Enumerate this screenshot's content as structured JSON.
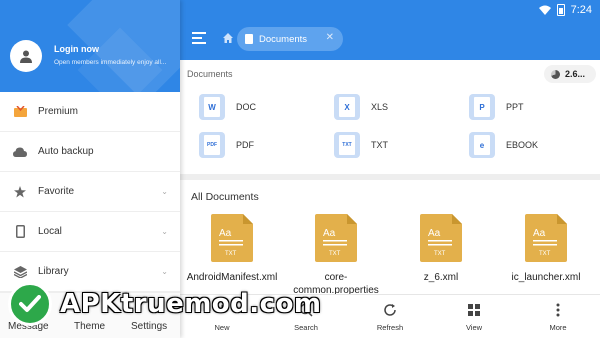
{
  "status_bar": {
    "time": "7:24"
  },
  "drawer": {
    "login_title": "Login now",
    "login_subtitle": "Open members immediately enjoy all...",
    "menu": [
      {
        "label": "Premium",
        "icon": "premium-icon",
        "chevron": false
      },
      {
        "label": "Auto backup",
        "icon": "cloud-upload-icon",
        "chevron": false
      },
      {
        "label": "Favorite",
        "icon": "star-icon",
        "chevron": true
      },
      {
        "label": "Local",
        "icon": "phone-icon",
        "chevron": true
      },
      {
        "label": "Library",
        "icon": "layers-icon",
        "chevron": true
      }
    ],
    "bottom": {
      "message": "Message",
      "theme": "Theme",
      "settings": "Settings"
    }
  },
  "app_bar": {
    "tab_label": "Documents"
  },
  "documents": {
    "section_label": "Documents",
    "storage_value": "2.6...",
    "categories": [
      {
        "label": "DOC",
        "badge": "W",
        "color": "#2f6fd6",
        "bg": "#c9dcf6"
      },
      {
        "label": "XLS",
        "badge": "X",
        "color": "#2f6fd6",
        "bg": "#c9dcf6"
      },
      {
        "label": "PPT",
        "badge": "P",
        "color": "#2f6fd6",
        "bg": "#c9dcf6"
      },
      {
        "label": "PDF",
        "badge": "PDF",
        "color": "#2f6fd6",
        "bg": "#c9dcf6"
      },
      {
        "label": "TXT",
        "badge": "TXT",
        "color": "#2f6fd6",
        "bg": "#c9dcf6"
      },
      {
        "label": "EBOOK",
        "badge": "e",
        "color": "#2f6fd6",
        "bg": "#c9dcf6"
      }
    ]
  },
  "all_documents": {
    "label": "All Documents",
    "file_icon_color": "#e3b04b",
    "files": [
      {
        "name": "AndroidManifest.xml",
        "type": "TXT"
      },
      {
        "name": "core-common.properties",
        "type": "TXT"
      },
      {
        "name": "z_6.xml",
        "type": "TXT"
      },
      {
        "name": "ic_launcher.xml",
        "type": "TXT"
      }
    ]
  },
  "bottom_bar": {
    "new": "New",
    "search": "Search",
    "refresh": "Refresh",
    "view": "View",
    "more": "More"
  },
  "watermark": {
    "text": "APKtruemod.com"
  },
  "colors": {
    "primary": "#2f86e6",
    "watermark_green": "#2da84a"
  }
}
